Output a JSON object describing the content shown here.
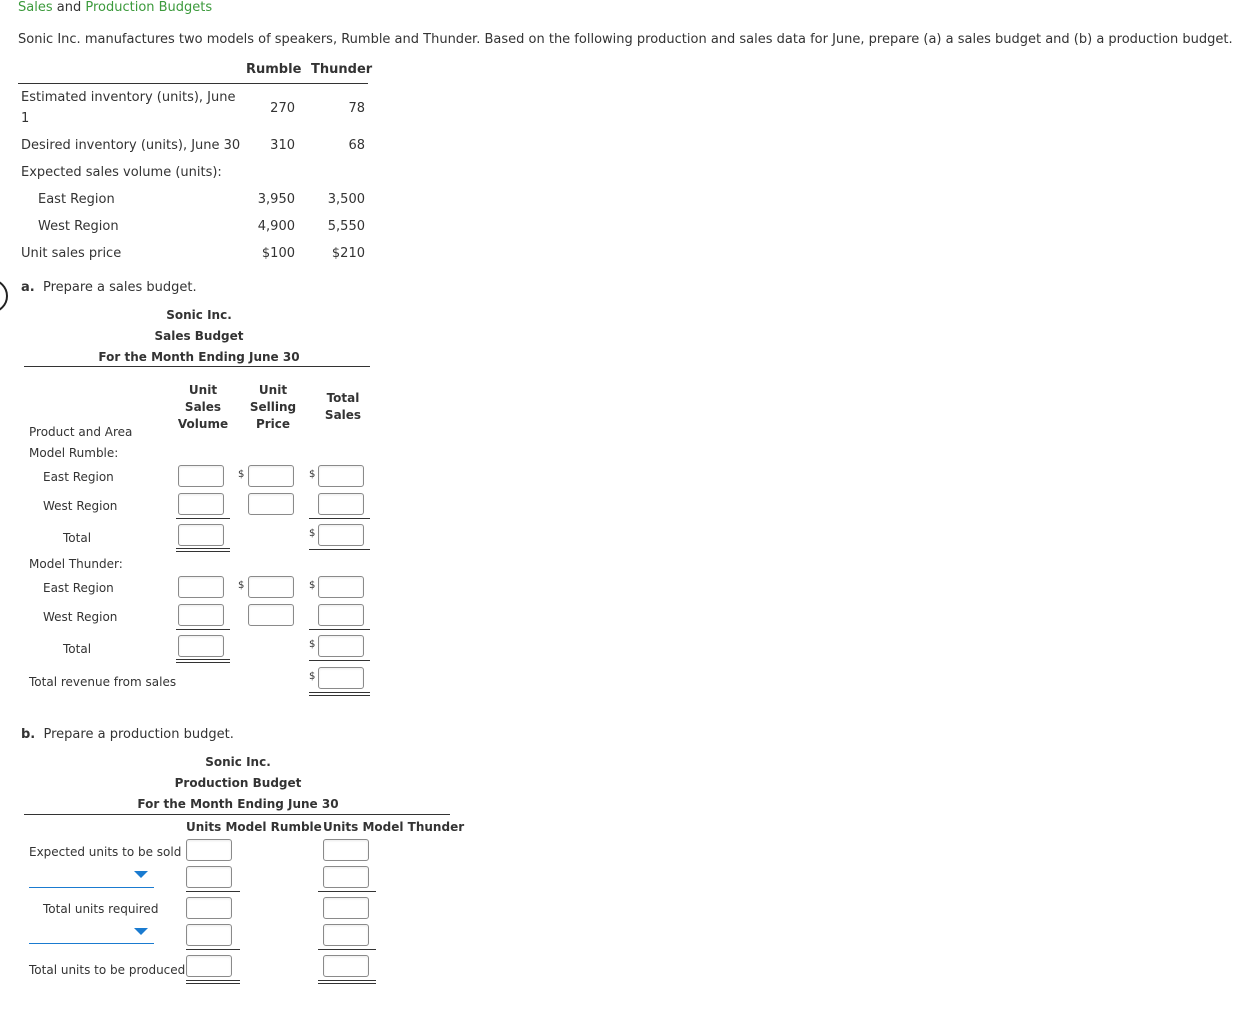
{
  "breadcrumb": {
    "part1": "Sales",
    "part2": " and ",
    "part3": "Production Budgets"
  },
  "intro": "Sonic Inc. manufactures two models of speakers, Rumble and Thunder. Based on the following production and sales data for June, prepare (a) a sales budget and (b) a production budget.",
  "data_table": {
    "col_rumble": "Rumble",
    "col_thunder": "Thunder",
    "rows": [
      {
        "label1": "Estimated inventory (units), June",
        "label2": "1",
        "rumble": "270",
        "thunder": "78"
      },
      {
        "label1": "Desired inventory (units), June 30",
        "rumble": "310",
        "thunder": "68"
      },
      {
        "label1": "Expected sales volume (units):"
      },
      {
        "label1": "East Region",
        "rumble": "3,950",
        "thunder": "3,500"
      },
      {
        "label1": "West Region",
        "rumble": "4,900",
        "thunder": "5,550"
      },
      {
        "label1": "Unit sales price",
        "rumble": "$100",
        "thunder": "$210"
      }
    ]
  },
  "part_a": {
    "prefix": "a.",
    "prompt": "Prepare a sales budget.",
    "company": "Sonic Inc.",
    "title": "Sales Budget",
    "period": "For the Month Ending June 30",
    "col1": [
      "Unit",
      "Sales",
      "Volume"
    ],
    "col2": [
      "Unit",
      "Selling",
      "Price"
    ],
    "col3": [
      "Total",
      "Sales"
    ],
    "product_area": "Product and Area",
    "model_rumble": "Model Rumble:",
    "model_thunder": "Model Thunder:",
    "east": "East Region",
    "west": "West Region",
    "total": "Total",
    "total_revenue": "Total revenue from sales",
    "dollar": "$"
  },
  "part_b": {
    "prefix": "b.",
    "prompt": "Prepare a production budget.",
    "company": "Sonic Inc.",
    "title": "Production Budget",
    "period": "For the Month Ending June 30",
    "col_rumble": "Units Model Rumble",
    "col_thunder": "Units Model Thunder",
    "expected": "Expected units to be sold",
    "total_required": "Total units required",
    "total_produced": "Total units to be produced"
  }
}
